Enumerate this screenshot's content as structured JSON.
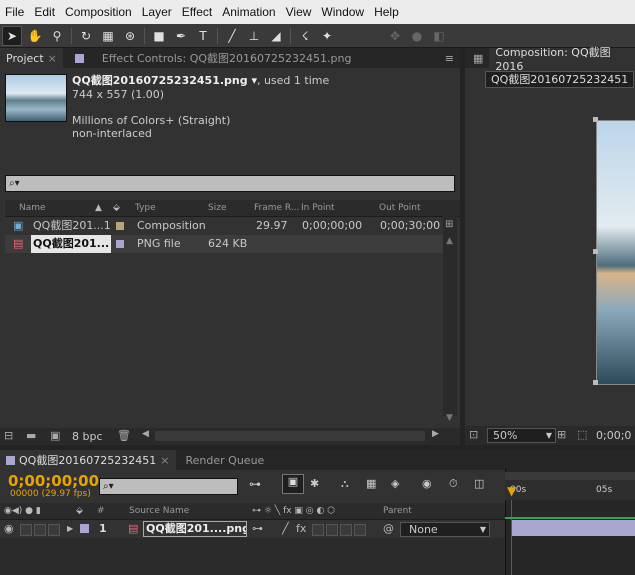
{
  "menu": [
    "File",
    "Edit",
    "Composition",
    "Layer",
    "Effect",
    "Animation",
    "View",
    "Window",
    "Help"
  ],
  "toolbar": {
    "tools": [
      "selection-tool",
      "hand-tool",
      "zoom-tool",
      "rotate-tool",
      "camera-tool",
      "pan-behind-tool",
      "rectangle-tool",
      "pen-tool",
      "type-tool",
      "brush-tool",
      "clone-stamp-tool",
      "eraser-tool",
      "roto-brush-tool",
      "puppet-tool"
    ]
  },
  "project_panel": {
    "tab_label": "Project",
    "effect_tab_label": "Effect Controls: QQ截图20160725232451.png",
    "item_name": "QQ截图20160725232451.png ▾",
    "used": ", used 1 time",
    "dimensions": "744 x 557 (1.00)",
    "colors": "Millions of Colors+ (Straight)",
    "interlace": "non-interlaced",
    "search_glyph": "⌕▾",
    "columns": {
      "name": "Name",
      "type": "Type",
      "size": "Size",
      "frame_rate": "Frame R...",
      "in_point": "In Point",
      "out_point": "Out Point"
    },
    "rows": [
      {
        "name": "QQ截图201...1",
        "type": "Composition",
        "size": "",
        "frame_rate": "29.97",
        "in_point": "0;00;00;00",
        "out_point": "0;00;30;00",
        "label_color": "#b5a77a"
      },
      {
        "name": "QQ截图201...",
        "type": "PNG file",
        "size": "624 KB",
        "frame_rate": "",
        "in_point": "",
        "out_point": "",
        "label_color": "#a9a6d2"
      }
    ],
    "bpc": "8 bpc"
  },
  "composition_panel": {
    "tab_label": "Composition: QQ截图2016",
    "comp_name_badge": "QQ截图20160725232451",
    "zoom": "50%",
    "timecode_fragment": "0;00;0"
  },
  "timeline": {
    "tab_label": "QQ截图20160725232451",
    "render_queue_label": "Render Queue",
    "timecode": "0;00;00;00",
    "fps": "00000 (29.97 fps)",
    "columns": {
      "num": "#",
      "source_name": "Source Name",
      "switches": "⊶ ☼ ╲ fx ▣ ◎ ◐ ⬡",
      "parent": "Parent"
    },
    "ruler": {
      "start": "00s",
      "mark": "05s"
    },
    "layers": [
      {
        "num": "1",
        "source_name": "QQ截图201....png",
        "parent": "None"
      }
    ]
  },
  "colors": {
    "accent": "#e8a400",
    "timeline_bar": "#a9a6d2",
    "label_comp": "#b5a77a"
  }
}
